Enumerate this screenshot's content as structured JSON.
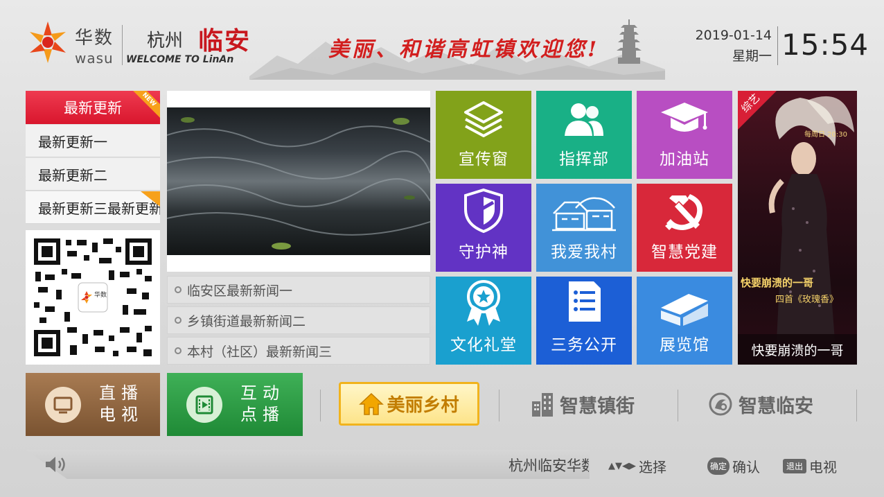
{
  "header": {
    "logo_cn": "华数",
    "logo_en": "wasu",
    "city": "杭州",
    "city_accent": "临安",
    "welcome": "WELCOME TO LinAn",
    "slogan": "美丽、和谐高虹镇欢迎您!",
    "date": "2019-01-14",
    "weekday": "星期一",
    "time": "15:54"
  },
  "latest": {
    "title": "最新更新",
    "badge": "NEW",
    "items": [
      "最新更新一",
      "最新更新二",
      "最新更新三最新更新"
    ]
  },
  "qr": {
    "center_label": "华数"
  },
  "news": {
    "items": [
      "临安区最新新闻一",
      "乡镇街道最新新闻二",
      "本村（社区）最新新闻三"
    ]
  },
  "tiles": [
    {
      "label": "宣传窗",
      "icon": "layers-icon",
      "color": "#82a21a"
    },
    {
      "label": "指挥部",
      "icon": "users-icon",
      "color": "#19b086"
    },
    {
      "label": "加油站",
      "icon": "graduation-cap-icon",
      "color": "#b84ec2"
    },
    {
      "label": "守护神",
      "icon": "shield-icon",
      "color": "#6233c4"
    },
    {
      "label": "我爱我村",
      "icon": "village-icon",
      "color": "#4192d8"
    },
    {
      "label": "智慧党建",
      "icon": "hammer-sickle-icon",
      "color": "#d8283a"
    },
    {
      "label": "文化礼堂",
      "icon": "award-ribbon-icon",
      "color": "#1aa0cf"
    },
    {
      "label": "三务公开",
      "icon": "document-list-icon",
      "color": "#1c5fd6"
    },
    {
      "label": "展览馆",
      "icon": "building-icon",
      "color": "#3a8be0"
    }
  ],
  "ad": {
    "corner_label": "综艺",
    "caption": "快要崩溃的一哥",
    "overlay_text": "快要崩溃的一哥",
    "overlay_sub": "四首《玫瑰香》",
    "airtime": "每周日 20:30"
  },
  "bottom_nav": {
    "live": {
      "line1": "直播",
      "line2": "电视"
    },
    "vod": {
      "line1": "互动",
      "line2": "点播"
    },
    "home": "美丽乡村",
    "town": "智慧镇街",
    "linan": "智慧临安"
  },
  "footer": {
    "ticker": "杭州临安华数欢迎您",
    "hint_arrows": "▲▼◀▶",
    "hint_select": "选择",
    "hint_ok_badge": "确定",
    "hint_ok": "确认",
    "hint_exit_badge": "退出",
    "hint_tv": "电视"
  }
}
